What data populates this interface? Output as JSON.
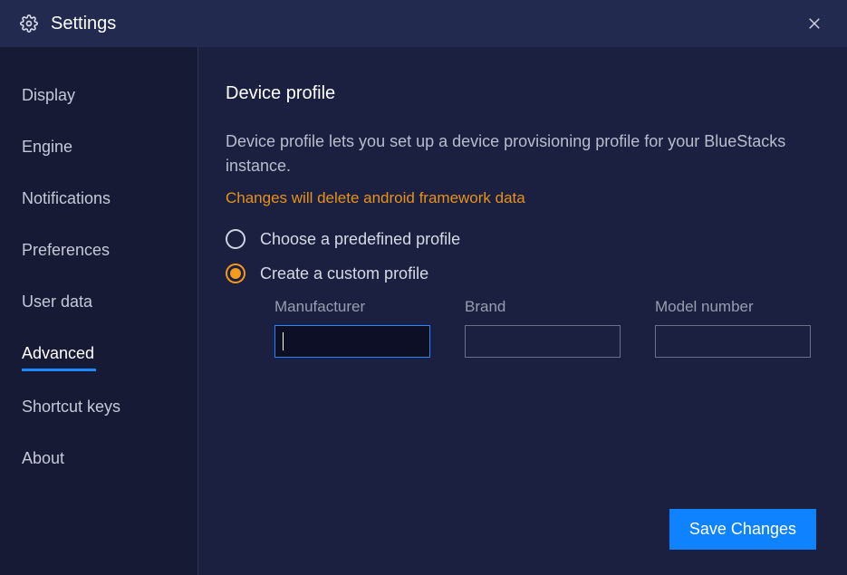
{
  "titlebar": {
    "title": "Settings"
  },
  "sidebar": {
    "items": [
      {
        "label": "Display",
        "active": false
      },
      {
        "label": "Engine",
        "active": false
      },
      {
        "label": "Notifications",
        "active": false
      },
      {
        "label": "Preferences",
        "active": false
      },
      {
        "label": "User data",
        "active": false
      },
      {
        "label": "Advanced",
        "active": true
      },
      {
        "label": "Shortcut keys",
        "active": false
      },
      {
        "label": "About",
        "active": false
      }
    ]
  },
  "main": {
    "section_title": "Device profile",
    "description": "Device profile lets you set up a device provisioning profile for your BlueStacks instance.",
    "warning": "Changes will delete android framework data",
    "radios": {
      "predefined": {
        "label": "Choose a predefined profile",
        "selected": false
      },
      "custom": {
        "label": "Create a custom profile",
        "selected": true
      }
    },
    "fields": {
      "manufacturer": {
        "label": "Manufacturer",
        "value": ""
      },
      "brand": {
        "label": "Brand",
        "value": ""
      },
      "model": {
        "label": "Model number",
        "value": ""
      }
    },
    "save_label": "Save Changes"
  },
  "colors": {
    "accent_blue": "#0f82ff",
    "accent_orange": "#f39a1f",
    "warning_text": "#e6921e",
    "bg_dark": "#171a34",
    "bg_panel": "#1b2040"
  }
}
